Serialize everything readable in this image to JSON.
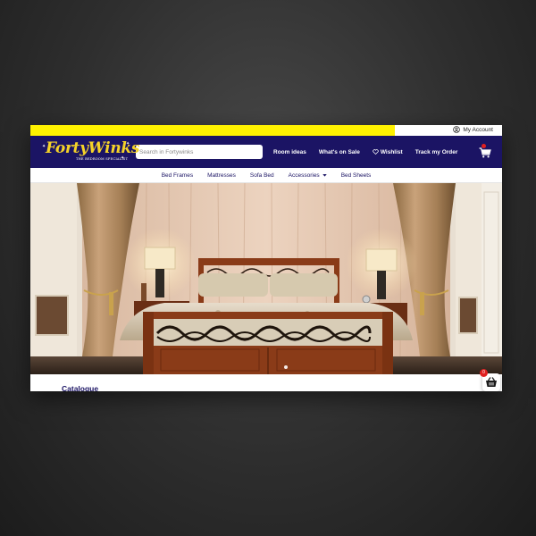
{
  "topbar": {
    "account_label": "My Account",
    "account_icon": "user-circle-icon"
  },
  "header": {
    "logo_text": "FortyWinks",
    "logo_tagline": "THE BEDROOM SPECIALIST",
    "search_placeholder": "Search in Fortywinks",
    "nav": [
      {
        "label": "Room ideas"
      },
      {
        "label": "What's on Sale"
      },
      {
        "label": "Wishlist",
        "icon": "heart-icon"
      },
      {
        "label": "Track my Order"
      }
    ],
    "cart_icon": "cart-icon"
  },
  "subnav": {
    "items": [
      {
        "label": "Bed Frames"
      },
      {
        "label": "Mattresses"
      },
      {
        "label": "Sofa Bed"
      },
      {
        "label": "Accessories",
        "icon": "caret-down-icon"
      },
      {
        "label": "Bed Sheets"
      }
    ]
  },
  "hero": {
    "image": "bedroom-hero-image",
    "slider_dot_icon": "slider-dot-icon"
  },
  "main": {
    "section_title": "Catalogue"
  },
  "basket": {
    "count": "0",
    "icon": "basket-icon"
  },
  "colors": {
    "brand_navy": "#1b1464",
    "brand_yellow": "#fff200",
    "logo_gold": "#f5d328",
    "badge_red": "#e02020"
  }
}
